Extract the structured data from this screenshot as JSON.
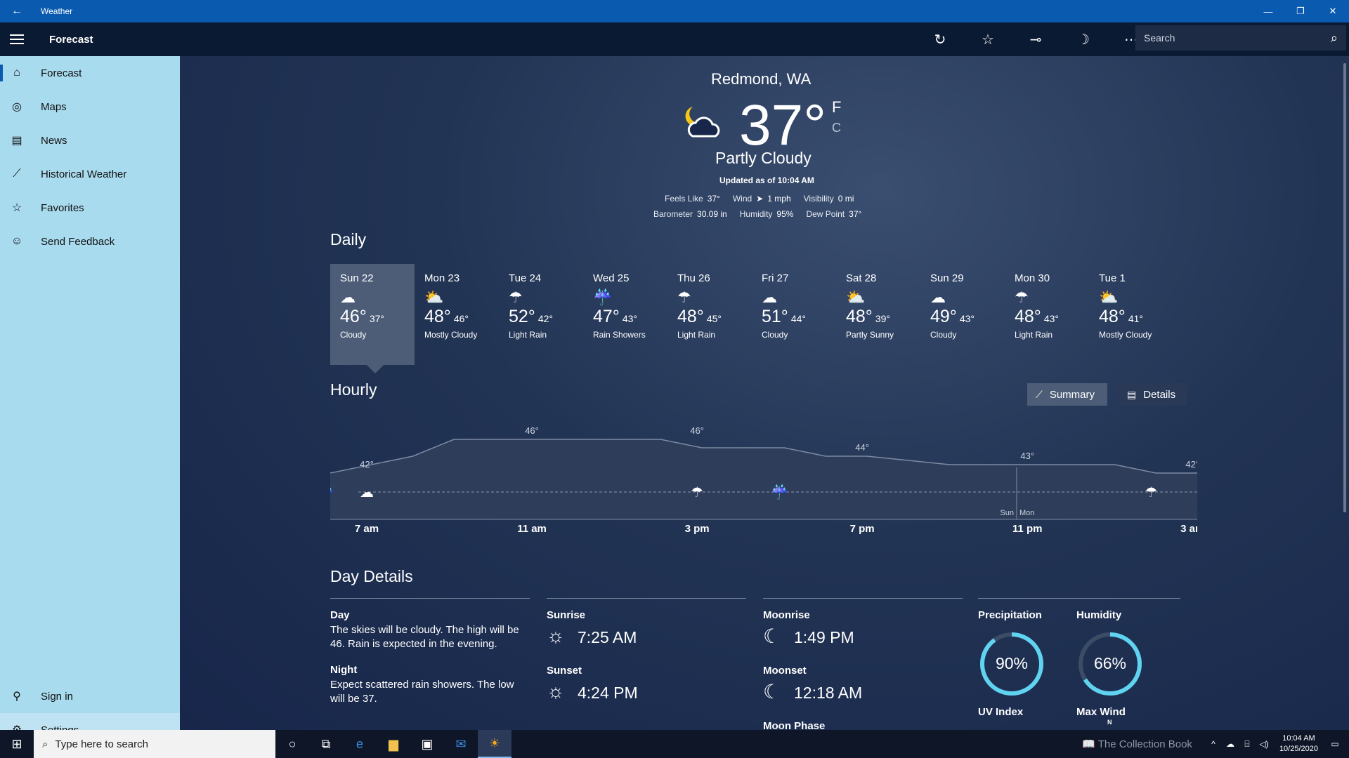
{
  "window": {
    "title": "Weather",
    "back_icon": "back-arrow-icon"
  },
  "header": {
    "page_title": "Forecast",
    "search_placeholder": "Search"
  },
  "sidebar": {
    "items": [
      {
        "label": "Forecast",
        "icon": "home-icon",
        "active": true
      },
      {
        "label": "Maps",
        "icon": "maps-icon"
      },
      {
        "label": "News",
        "icon": "news-icon"
      },
      {
        "label": "Historical Weather",
        "icon": "chart-icon"
      },
      {
        "label": "Favorites",
        "icon": "favorites-icon"
      },
      {
        "label": "Send Feedback",
        "icon": "smiley-icon"
      }
    ],
    "bottom": [
      {
        "label": "Sign in",
        "icon": "person-icon"
      },
      {
        "label": "Settings",
        "icon": "gear-icon"
      }
    ]
  },
  "current": {
    "location": "Redmond, WA",
    "temp": "37°",
    "unit_f": "F",
    "unit_c": "C",
    "condition": "Partly Cloudy",
    "updated": "Updated as of 10:04 AM",
    "feels_like_label": "Feels Like",
    "feels_like": "37°",
    "wind_label": "Wind",
    "wind": "1 mph",
    "visibility_label": "Visibility",
    "visibility": "0 mi",
    "barometer_label": "Barometer",
    "barometer": "30.09 in",
    "humidity_label": "Humidity",
    "humidity": "95%",
    "dewpoint_label": "Dew Point",
    "dewpoint": "37°"
  },
  "daily": {
    "title": "Daily",
    "days": [
      {
        "name": "Sun 22",
        "hi": "46°",
        "lo": "37°",
        "cond": "Cloudy",
        "icon": "cloud-icon",
        "selected": true
      },
      {
        "name": "Mon 23",
        "hi": "48°",
        "lo": "46°",
        "cond": "Mostly Cloudy",
        "icon": "sun-cloud-icon"
      },
      {
        "name": "Tue 24",
        "hi": "52°",
        "lo": "42°",
        "cond": "Light Rain",
        "icon": "rain-icon"
      },
      {
        "name": "Wed 25",
        "hi": "47°",
        "lo": "43°",
        "cond": "Rain Showers",
        "icon": "sun-rain-icon"
      },
      {
        "name": "Thu 26",
        "hi": "48°",
        "lo": "45°",
        "cond": "Light Rain",
        "icon": "rain-icon"
      },
      {
        "name": "Fri 27",
        "hi": "51°",
        "lo": "44°",
        "cond": "Cloudy",
        "icon": "cloud-icon"
      },
      {
        "name": "Sat 28",
        "hi": "48°",
        "lo": "39°",
        "cond": "Partly Sunny",
        "icon": "sun-cloud-icon"
      },
      {
        "name": "Sun 29",
        "hi": "49°",
        "lo": "43°",
        "cond": "Cloudy",
        "icon": "cloud-icon"
      },
      {
        "name": "Mon 30",
        "hi": "48°",
        "lo": "43°",
        "cond": "Light Rain",
        "icon": "rain-icon"
      },
      {
        "name": "Tue 1",
        "hi": "48°",
        "lo": "41°",
        "cond": "Mostly Cloudy",
        "icon": "sun-cloud-icon"
      }
    ]
  },
  "hourly": {
    "title": "Hourly",
    "summary_label": "Summary",
    "details_label": "Details",
    "day_split": [
      "Sun",
      "Mon"
    ]
  },
  "chart_data": {
    "type": "area",
    "x": [
      "7 am",
      "8 am",
      "9 am",
      "10 am",
      "11 am",
      "12 pm",
      "1 pm",
      "2 pm",
      "3 pm",
      "4 pm",
      "5 pm",
      "6 pm",
      "7 pm",
      "8 pm",
      "9 pm",
      "10 pm",
      "11 pm",
      "12 am",
      "1 am",
      "2 am",
      "3 am",
      "4 am"
    ],
    "xticks": [
      "7 am",
      "11 am",
      "3 pm",
      "7 pm",
      "11 pm",
      "3 am"
    ],
    "values": [
      42,
      43,
      44,
      46,
      46,
      46,
      46,
      46,
      46,
      45,
      45,
      45,
      44,
      44,
      43.5,
      43,
      43,
      43,
      43,
      43,
      42,
      42
    ],
    "point_labels": [
      {
        "x": "7 am",
        "label": "42°"
      },
      {
        "x": "11 am",
        "label": "46°"
      },
      {
        "x": "3 pm",
        "label": "46°"
      },
      {
        "x": "7 pm",
        "label": "44°"
      },
      {
        "x": "11 pm",
        "label": "43°"
      },
      {
        "x": "3 am",
        "label": "42°"
      }
    ],
    "icons": [
      {
        "x": "7 am",
        "icon": "cloud-icon"
      },
      {
        "x": "3 pm",
        "icon": "rain-icon"
      },
      {
        "x": "5 pm",
        "icon": "sun-rain-icon"
      },
      {
        "x": "2 am",
        "icon": "rain-icon"
      },
      {
        "x": "5 am",
        "icon": "sun-rain-icon"
      }
    ],
    "ylim": [
      38,
      48
    ]
  },
  "day_details": {
    "title": "Day Details",
    "day_label": "Day",
    "day_text": "The skies will be cloudy. The high will be 46. Rain is expected in the evening.",
    "night_label": "Night",
    "night_text": "Expect scattered rain showers. The low will be 37.",
    "sunrise_label": "Sunrise",
    "sunrise": "7:25 AM",
    "sunset_label": "Sunset",
    "sunset": "4:24 PM",
    "moonrise_label": "Moonrise",
    "moonrise": "1:49 PM",
    "moonset_label": "Moonset",
    "moonset": "12:18 AM",
    "moonphase_label": "Moon Phase",
    "precip_label": "Precipitation",
    "precip": "90%",
    "precip_value": 0.9,
    "humidity_label": "Humidity",
    "humidity": "66%",
    "humidity_value": 0.66,
    "uv_label": "UV Index",
    "maxwind_label": "Max Wind",
    "compass_n": "N"
  },
  "taskbar": {
    "search_placeholder": "Type here to search",
    "time": "10:04 AM",
    "date": "10/25/2020",
    "watermark": "The Collection Book"
  },
  "colors": {
    "titlebar": "#0a5bb0",
    "sidebar": "#a9dbef",
    "accent_ring": "#5fd3f0"
  }
}
